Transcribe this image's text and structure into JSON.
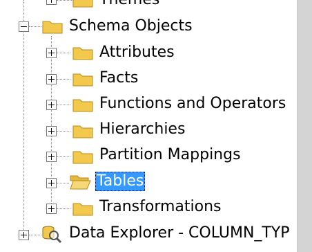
{
  "tree": {
    "nodes": [
      {
        "label": "Themes",
        "icon": "folder-icon",
        "expanded": false
      },
      {
        "label": "Schema Objects",
        "icon": "folder-icon",
        "expanded": true
      },
      {
        "label": "Attributes",
        "icon": "folder-icon",
        "expanded": false
      },
      {
        "label": "Facts",
        "icon": "folder-icon",
        "expanded": false
      },
      {
        "label": "Functions and Operators",
        "icon": "folder-icon",
        "expanded": false
      },
      {
        "label": "Hierarchies",
        "icon": "folder-icon",
        "expanded": false
      },
      {
        "label": "Partition Mappings",
        "icon": "folder-icon",
        "expanded": false
      },
      {
        "label": "Tables",
        "icon": "open-folder-icon",
        "expanded": false,
        "selected": true
      },
      {
        "label": "Transformations",
        "icon": "folder-icon",
        "expanded": false
      },
      {
        "label": "Data Explorer - COLUMN_TYP",
        "icon": "data-explorer-icon",
        "expanded": false
      }
    ]
  },
  "colors": {
    "selection": "#3399ff",
    "folder": "#f2c94c",
    "scrollbar": "#d4d4d4"
  }
}
